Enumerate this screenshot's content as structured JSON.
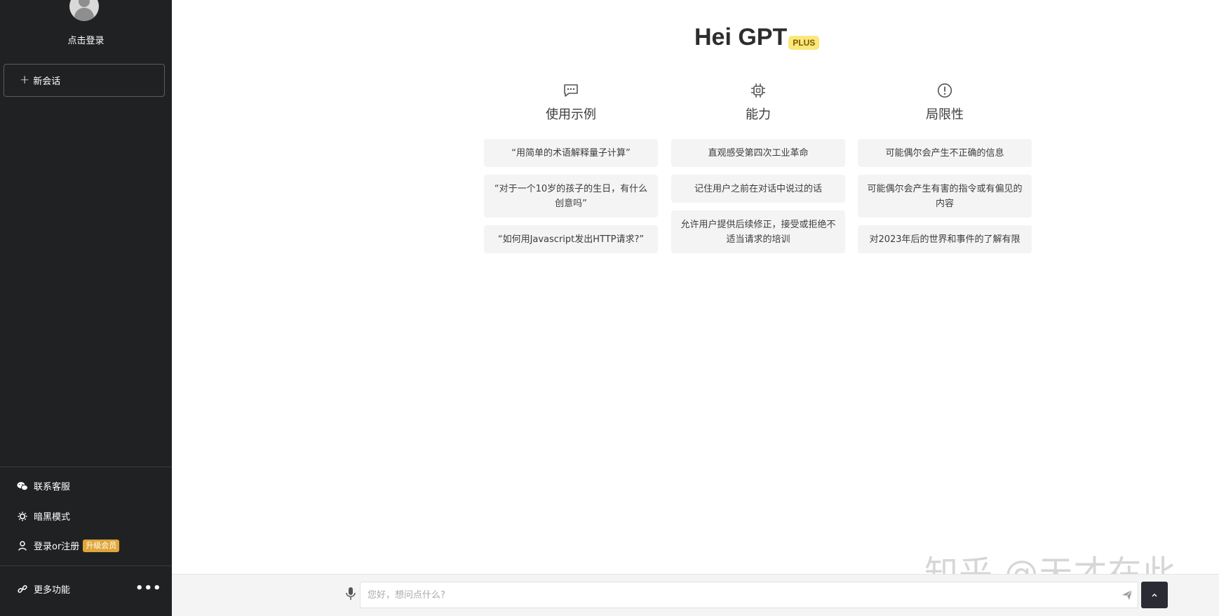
{
  "sidebar": {
    "login_label": "点击登录",
    "new_chat_label": "新会话",
    "items": [
      {
        "label": "联系客服",
        "icon": "wechat-icon"
      },
      {
        "label": "暗黑模式",
        "icon": "sun-icon"
      },
      {
        "label": "登录or注册",
        "icon": "user-icon",
        "badge": "升级会员"
      }
    ],
    "more_label": "更多功能",
    "more_icon": "link-icon",
    "more_dots": "•••"
  },
  "main": {
    "title": "Hei GPT",
    "title_badge": "PLUS",
    "columns": [
      {
        "icon": "chat-bubble-icon",
        "heading": "使用示例",
        "cards": [
          "“用简单的术语解释量子计算”",
          "“对于一个10岁的孩子的生日，有什么创意吗”",
          "“如何用Javascript发出HTTP请求?”"
        ]
      },
      {
        "icon": "cpu-chip-icon",
        "heading": "能力",
        "cards": [
          "直观感受第四次工业革命",
          "记住用户之前在对话中说过的话",
          "允许用户提供后续修正，接受或拒绝不适当请求的培训"
        ]
      },
      {
        "icon": "warning-circle-icon",
        "heading": "局限性",
        "cards": [
          "可能偶尔会产生不正确的信息",
          "可能偶尔会产生有害的指令或有偏见的内容",
          "对2023年后的世界和事件的了解有限"
        ]
      }
    ]
  },
  "input": {
    "placeholder": "您好，想问点什么?",
    "value": ""
  },
  "watermark": "知乎 @天才在此",
  "colors": {
    "sidebar_bg": "#202123",
    "badge_upgrade": "#e0a63a",
    "plus_badge": "#fbe77a",
    "card_bg": "#f4f4f5"
  }
}
